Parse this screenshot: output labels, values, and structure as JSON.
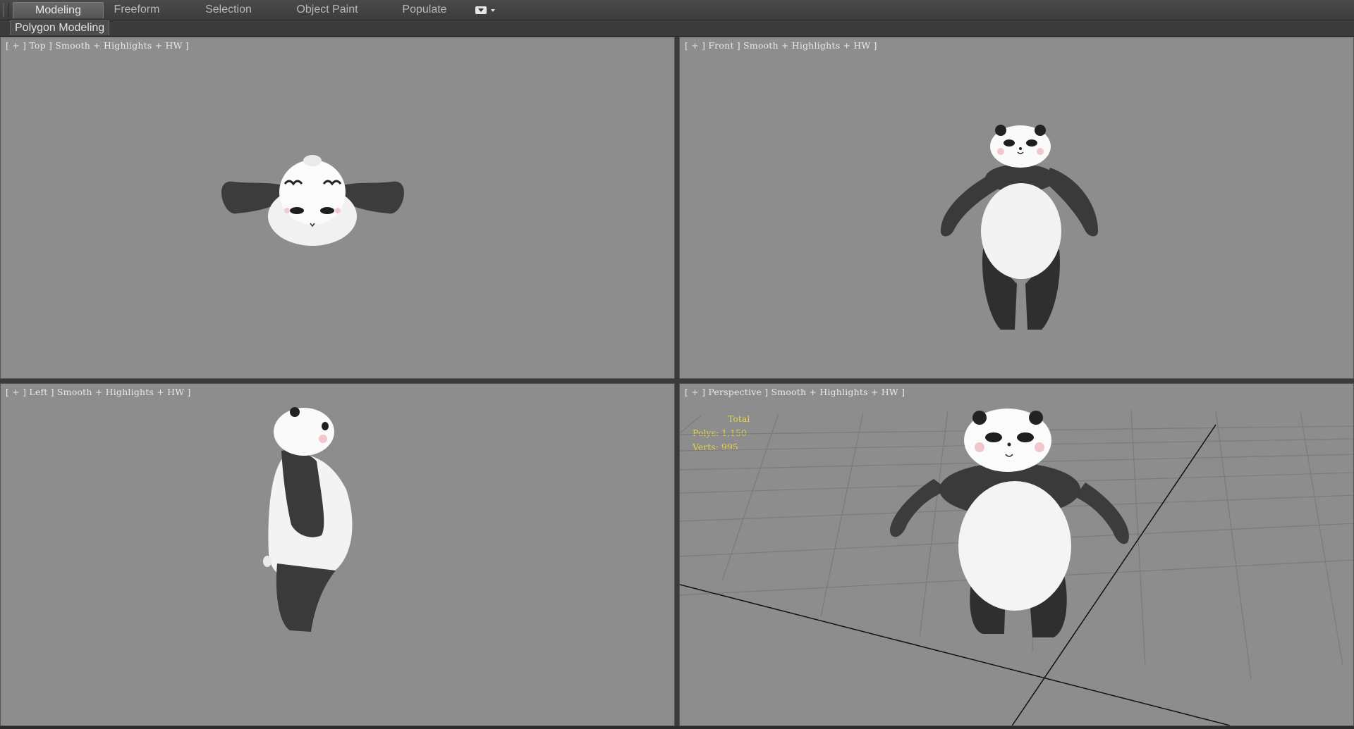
{
  "ribbon": {
    "tabs": [
      {
        "label": "Modeling",
        "active": true
      },
      {
        "label": "Freeform",
        "active": false
      },
      {
        "label": "Selection",
        "active": false
      },
      {
        "label": "Object Paint",
        "active": false
      },
      {
        "label": "Populate",
        "active": false
      }
    ],
    "panel_label": "Polygon Modeling"
  },
  "viewports": {
    "top": {
      "label": "[ + ] Top ] Smooth + Highlights + HW ]"
    },
    "front": {
      "label": "[ + ] Front ] Smooth + Highlights + HW ]"
    },
    "left": {
      "label": "[ + ] Left ] Smooth + Highlights + HW ]"
    },
    "perspective": {
      "label": "[ + ] Perspective ] Smooth + Highlights + HW ]",
      "stats": {
        "header": "Total",
        "polys": "Polys: 1,150",
        "verts": "Verts: 995"
      }
    }
  },
  "colors": {
    "viewport_bg": "#8d8d8d",
    "stats_text": "#e3d24a",
    "panda_black": "#3a3a3a",
    "panda_white": "#f2f2f2"
  }
}
